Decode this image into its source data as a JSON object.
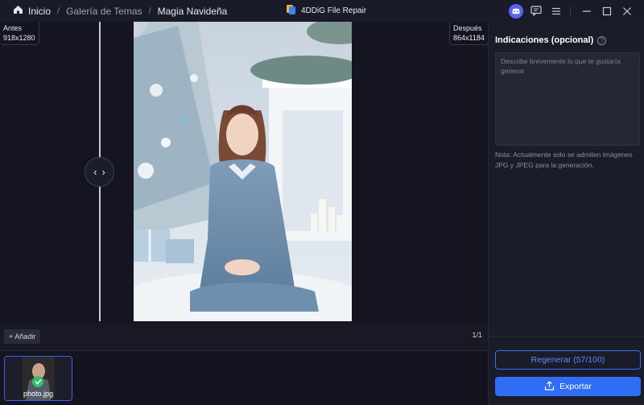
{
  "titlebar": {
    "home_label": "Inicio",
    "crumb_gallery": "Galería de Temas",
    "crumb_current": "Magia Navideña",
    "app_name": "4DDiG File Repair",
    "icons": [
      "home-icon",
      "app-logo-icon",
      "discord-icon",
      "feedback-icon",
      "menu-icon",
      "minimize-icon",
      "maximize-icon",
      "close-icon"
    ]
  },
  "canvas": {
    "before_label": "Antes",
    "before_size": "918x1280",
    "after_label": "Después",
    "after_size": "864x1184",
    "handle_left": "‹",
    "handle_right": "›"
  },
  "strip": {
    "add_label": "+ Añadir",
    "counter": "1/1"
  },
  "thumbnails": [
    {
      "name": "photo.jpg",
      "status": "done"
    }
  ],
  "panel": {
    "title": "Indicaciones (opcional)",
    "help_glyph": "?",
    "prompt_placeholder": "Describe brevemente lo que te gustaría generar",
    "note": "Nota: Actualmente solo se admiten imágenes JPG y JPEG para la generación.",
    "regenerate_label": "Regenerar (57/100)",
    "export_label": "Exportar"
  },
  "colors": {
    "accent": "#2f6df5",
    "accent_text": "#5b8bff",
    "success": "#33c26a",
    "background": "#13141f",
    "panel": "#1b1c29"
  }
}
